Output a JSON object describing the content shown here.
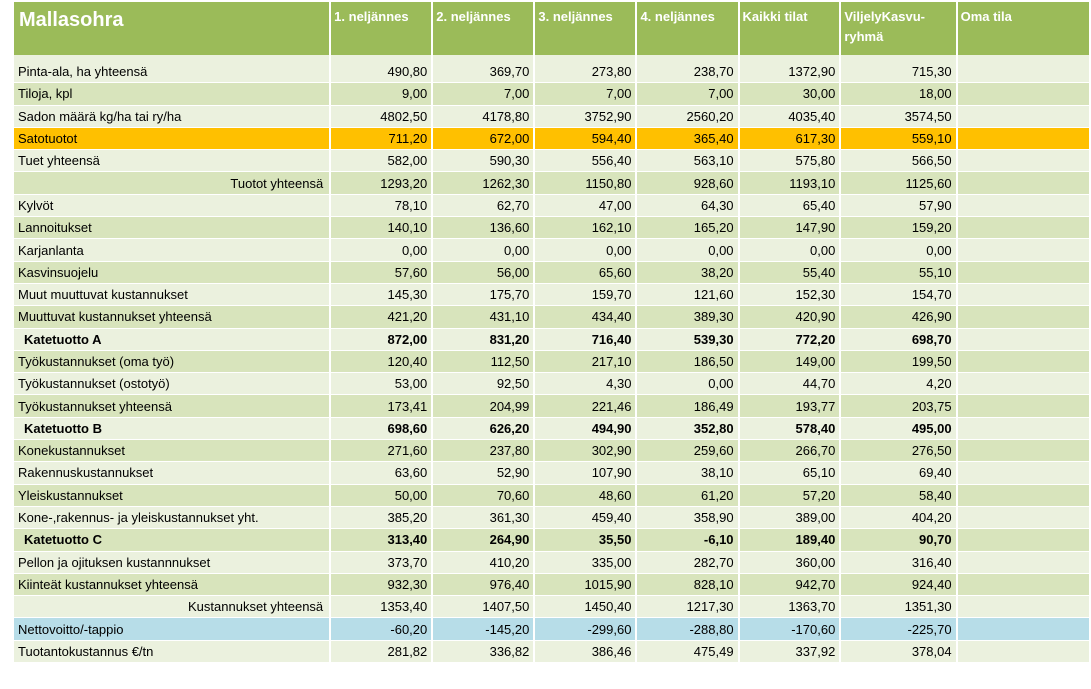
{
  "title": "Mallasohra",
  "headers": [
    "1. neljännes",
    "2. neljännes",
    "3. neljännes",
    "4. neljännes",
    "Kaikki tilat",
    "ViljelyKasvu-ryhmä",
    "Oma tila"
  ],
  "rows": [
    {
      "label": "Pinta-ala, ha yhteensä",
      "values": [
        "490,80",
        "369,70",
        "273,80",
        "238,70",
        "1372,90",
        "715,30",
        ""
      ]
    },
    {
      "label": "Tiloja, kpl",
      "values": [
        "9,00",
        "7,00",
        "7,00",
        "7,00",
        "30,00",
        "18,00",
        ""
      ]
    },
    {
      "label": "Sadon määrä kg/ha tai ry/ha",
      "values": [
        "4802,50",
        "4178,80",
        "3752,90",
        "2560,20",
        "4035,40",
        "3574,50",
        ""
      ]
    },
    {
      "label": "Satotuotot",
      "values": [
        "711,20",
        "672,00",
        "594,40",
        "365,40",
        "617,30",
        "559,10",
        ""
      ]
    },
    {
      "label": "Tuet yhteensä",
      "values": [
        "582,00",
        "590,30",
        "556,40",
        "563,10",
        "575,80",
        "566,50",
        ""
      ]
    },
    {
      "label": "Tuotot yhteensä",
      "values": [
        "1293,20",
        "1262,30",
        "1150,80",
        "928,60",
        "1193,10",
        "1125,60",
        ""
      ]
    },
    {
      "label": "Kylvöt",
      "values": [
        "78,10",
        "62,70",
        "47,00",
        "64,30",
        "65,40",
        "57,90",
        ""
      ]
    },
    {
      "label": "Lannoitukset",
      "values": [
        "140,10",
        "136,60",
        "162,10",
        "165,20",
        "147,90",
        "159,20",
        ""
      ]
    },
    {
      "label": "Karjanlanta",
      "values": [
        "0,00",
        "0,00",
        "0,00",
        "0,00",
        "0,00",
        "0,00",
        ""
      ]
    },
    {
      "label": "Kasvinsuojelu",
      "values": [
        "57,60",
        "56,00",
        "65,60",
        "38,20",
        "55,40",
        "55,10",
        ""
      ]
    },
    {
      "label": "Muut muuttuvat kustannukset",
      "values": [
        "145,30",
        "175,70",
        "159,70",
        "121,60",
        "152,30",
        "154,70",
        ""
      ]
    },
    {
      "label": "Muuttuvat kustannukset yhteensä",
      "values": [
        "421,20",
        "431,10",
        "434,40",
        "389,30",
        "420,90",
        "426,90",
        ""
      ]
    },
    {
      "label": "Katetuotto A",
      "values": [
        "872,00",
        "831,20",
        "716,40",
        "539,30",
        "772,20",
        "698,70",
        ""
      ]
    },
    {
      "label": "Työkustannukset (oma työ)",
      "values": [
        "120,40",
        "112,50",
        "217,10",
        "186,50",
        "149,00",
        "199,50",
        ""
      ]
    },
    {
      "label": "Työkustannukset (ostotyö)",
      "values": [
        "53,00",
        "92,50",
        "4,30",
        "0,00",
        "44,70",
        "4,20",
        ""
      ]
    },
    {
      "label": "Työkustannukset yhteensä",
      "values": [
        "173,41",
        "204,99",
        "221,46",
        "186,49",
        "193,77",
        "203,75",
        ""
      ]
    },
    {
      "label": "Katetuotto B",
      "values": [
        "698,60",
        "626,20",
        "494,90",
        "352,80",
        "578,40",
        "495,00",
        ""
      ]
    },
    {
      "label": "Konekustannukset",
      "values": [
        "271,60",
        "237,80",
        "302,90",
        "259,60",
        "266,70",
        "276,50",
        ""
      ]
    },
    {
      "label": "Rakennuskustannukset",
      "values": [
        "63,60",
        "52,90",
        "107,90",
        "38,10",
        "65,10",
        "69,40",
        ""
      ]
    },
    {
      "label": "Yleiskustannukset",
      "values": [
        "50,00",
        "70,60",
        "48,60",
        "61,20",
        "57,20",
        "58,40",
        ""
      ]
    },
    {
      "label": "Kone-,rakennus- ja yleiskustannukset yht.",
      "values": [
        "385,20",
        "361,30",
        "459,40",
        "358,90",
        "389,00",
        "404,20",
        ""
      ]
    },
    {
      "label": "Katetuotto C",
      "values": [
        "313,40",
        "264,90",
        "35,50",
        "-6,10",
        "189,40",
        "90,70",
        ""
      ]
    },
    {
      "label": "Pellon ja ojituksen kustannnukset",
      "values": [
        "373,70",
        "410,20",
        "335,00",
        "282,70",
        "360,00",
        "316,40",
        ""
      ]
    },
    {
      "label": "Kiinteät kustannukset yhteensä",
      "values": [
        "932,30",
        "976,40",
        "1015,90",
        "828,10",
        "942,70",
        "924,40",
        ""
      ]
    },
    {
      "label": "Kustannukset yhteensä",
      "values": [
        "1353,40",
        "1407,50",
        "1450,40",
        "1217,30",
        "1363,70",
        "1351,30",
        ""
      ]
    },
    {
      "label": "Nettovoitto/-tappio",
      "values": [
        "-60,20",
        "-145,20",
        "-299,60",
        "-288,80",
        "-170,60",
        "-225,70",
        ""
      ]
    },
    {
      "label": "Tuotantokustannus €/tn",
      "values": [
        "281,82",
        "336,82",
        "386,46",
        "475,49",
        "337,92",
        "378,04",
        ""
      ]
    }
  ]
}
